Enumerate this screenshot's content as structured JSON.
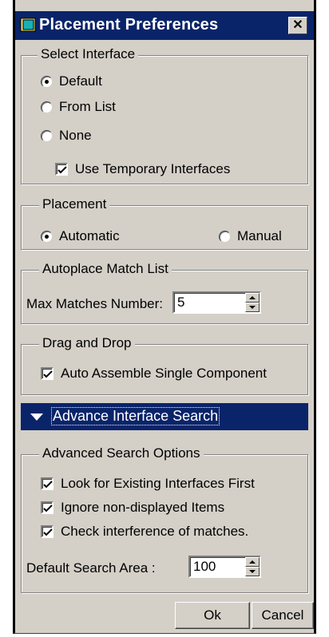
{
  "window": {
    "title": "Placement Preferences",
    "close_glyph": "✕"
  },
  "select_interface": {
    "label": "Select Interface",
    "options": [
      {
        "label": "Default",
        "selected": true
      },
      {
        "label": "From List",
        "selected": false
      },
      {
        "label": "None",
        "selected": false
      }
    ],
    "use_temporary": {
      "label": "Use Temporary Interfaces",
      "checked": true
    }
  },
  "placement": {
    "label": "Placement",
    "automatic": {
      "label": "Automatic",
      "selected": true
    },
    "manual": {
      "label": "Manual",
      "selected": false
    }
  },
  "autoplace": {
    "label": "Autoplace Match List",
    "max_matches_label": "Max Matches Number:",
    "max_matches_value": "5"
  },
  "drag_drop": {
    "label": "Drag and Drop",
    "auto_assemble": {
      "label": "Auto Assemble Single Component",
      "checked": true
    }
  },
  "advance": {
    "label": "Advance Interface Search"
  },
  "advanced_options": {
    "label": "Advanced Search Options",
    "look_existing": {
      "label": "Look for Existing Interfaces First",
      "checked": true
    },
    "ignore_hidden": {
      "label": "Ignore non-displayed Items",
      "checked": true
    },
    "check_interference": {
      "label": "Check interference of matches.",
      "checked": true
    },
    "search_area_label": "Default Search Area  :",
    "search_area_value": "100"
  },
  "buttons": {
    "ok": "Ok",
    "cancel": "Cancel"
  },
  "colors": {
    "titlebar": "#0a246a",
    "face": "#d4d0c8",
    "window_icon": "#18b0b8"
  }
}
